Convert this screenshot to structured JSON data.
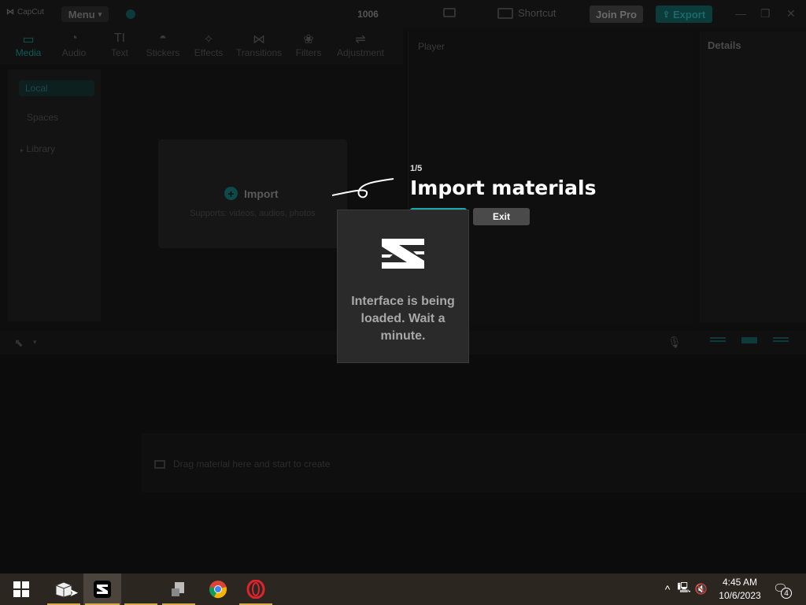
{
  "titlebar": {
    "app_name": "CapCut",
    "menu_label": "Menu",
    "project_title": "1006",
    "shortcut_label": "Shortcut",
    "join_pro_label": "Join Pro",
    "export_label": "Export"
  },
  "toolbar": {
    "items": [
      {
        "label": "Media",
        "icon": "media-icon"
      },
      {
        "label": "Audio",
        "icon": "audio-icon"
      },
      {
        "label": "Text",
        "icon": "text-icon"
      },
      {
        "label": "Stickers",
        "icon": "stickers-icon"
      },
      {
        "label": "Effects",
        "icon": "effects-icon"
      },
      {
        "label": "Transitions",
        "icon": "transitions-icon"
      },
      {
        "label": "Filters",
        "icon": "filters-icon"
      },
      {
        "label": "Adjustment",
        "icon": "adjustment-icon"
      }
    ]
  },
  "leftnav": {
    "items": [
      "Local",
      "Spaces",
      "Library"
    ]
  },
  "media": {
    "import_label": "Import",
    "import_sub": "Supports: videos, audios, photos"
  },
  "player": {
    "title": "Player"
  },
  "details": {
    "title": "Details"
  },
  "timeline": {
    "drag_hint": "Drag material here and start to create"
  },
  "guide": {
    "step": "1/5",
    "title": "Import materials",
    "exit_label": "Exit"
  },
  "loading": {
    "message": "Interface is being loaded. Wait a minute."
  },
  "taskbar": {
    "time": "4:45 AM",
    "date": "10/6/2023",
    "notification_count": "4"
  },
  "colors": {
    "accent": "#1aa8b0",
    "taskbar": "#2c2620",
    "taskbar_underline": "#d6a94a"
  }
}
